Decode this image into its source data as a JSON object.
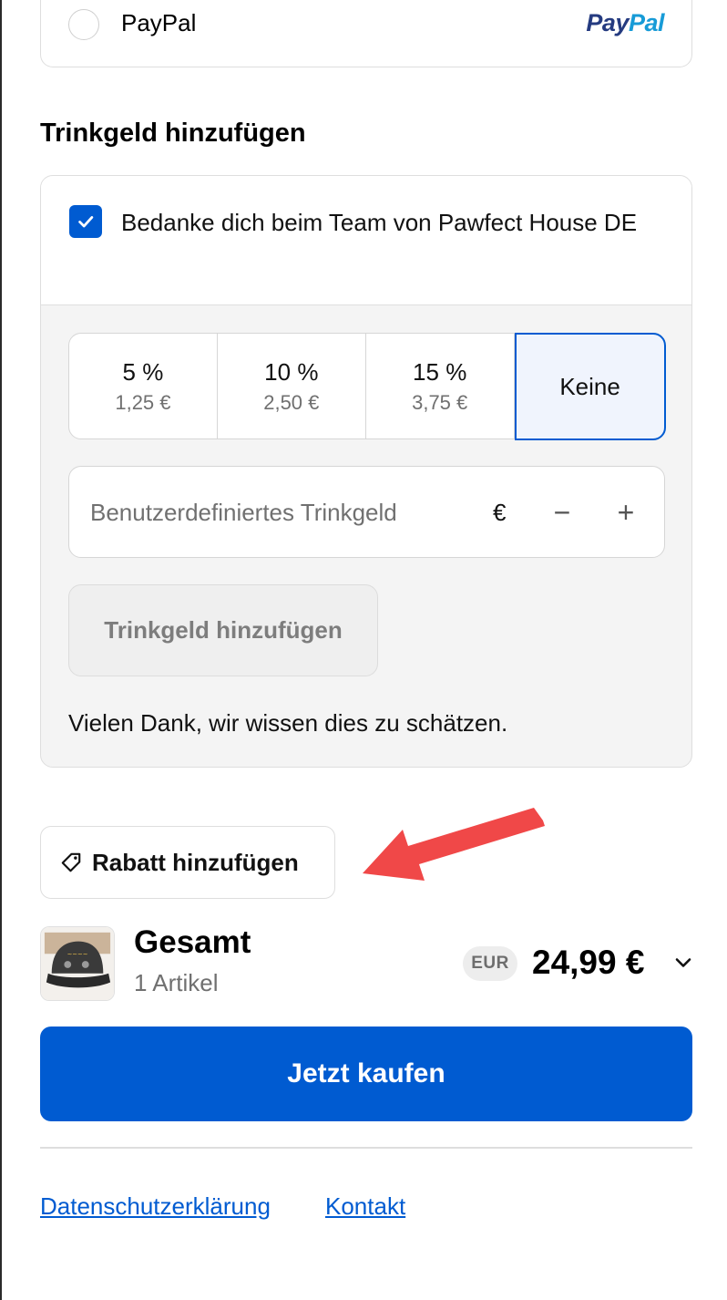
{
  "payment": {
    "option_label": "PayPal",
    "logo_pay": "Pay",
    "logo_pal": "Pal"
  },
  "tip": {
    "title": "Trinkgeld hinzufügen",
    "checkbox_label": "Bedanke dich beim Team von Pawfect House DE",
    "checkbox_checked": true,
    "options": [
      {
        "percent": "5 %",
        "amount": "1,25 €",
        "selected": false
      },
      {
        "percent": "10 %",
        "amount": "2,50 €",
        "selected": false
      },
      {
        "percent": "15 %",
        "amount": "3,75 €",
        "selected": false
      },
      {
        "percent": "Keine",
        "amount": "",
        "selected": true
      }
    ],
    "custom_placeholder": "Benutzerdefiniertes Trinkgeld",
    "currency_symbol": "€",
    "minus_symbol": "−",
    "plus_symbol": "+",
    "add_button": "Trinkgeld hinzufügen",
    "thanks_text": "Vielen Dank, wir wissen dies zu schätzen."
  },
  "discount": {
    "button_label": "Rabatt hinzufügen"
  },
  "summary": {
    "title": "Gesamt",
    "items": "1 Artikel",
    "currency": "EUR",
    "total": "24,99 €"
  },
  "buy_button": "Jetzt kaufen",
  "footer": {
    "links": [
      "Datenschutzerklärung",
      "Kontakt"
    ]
  },
  "colors": {
    "primary": "#005bd1",
    "annotation_arrow": "#f04848"
  }
}
